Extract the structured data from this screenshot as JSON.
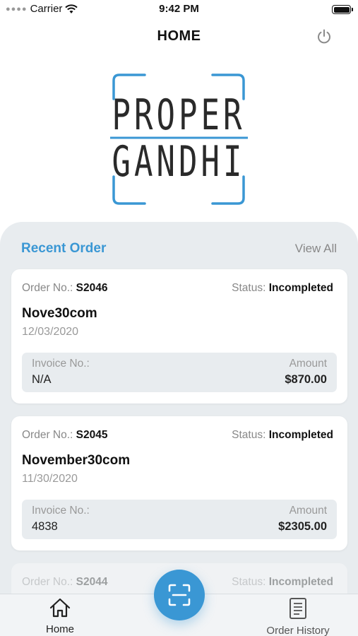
{
  "status_bar": {
    "carrier": "Carrier",
    "time": "9:42 PM"
  },
  "header": {
    "title": "HOME",
    "power_icon": "power-icon"
  },
  "logo": {
    "line1": "PROPER",
    "line2": "GANDHI",
    "accent_color": "#3a97d4"
  },
  "recent_orders": {
    "title": "Recent Order",
    "view_all": "View All",
    "orders": [
      {
        "order_label": "Order No.:",
        "order_no": "S2046",
        "status_label": "Status:",
        "status": "Incompleted",
        "name": "Nove30com",
        "date": "12/03/2020",
        "invoice_label": "Invoice No.:",
        "invoice_no": "N/A",
        "amount_label": "Amount",
        "amount": "$870.00"
      },
      {
        "order_label": "Order No.:",
        "order_no": "S2045",
        "status_label": "Status:",
        "status": "Incompleted",
        "name": "November30com",
        "date": "11/30/2020",
        "invoice_label": "Invoice No.:",
        "invoice_no": "4838",
        "amount_label": "Amount",
        "amount": "$2305.00"
      },
      {
        "order_label": "Order No.:",
        "order_no": "S2044",
        "status_label": "Status:",
        "status": "Incompleted"
      }
    ]
  },
  "tabbar": {
    "home_label": "Home",
    "history_label": "Order History",
    "scan_icon": "scan-icon"
  },
  "colors": {
    "accent": "#3a97d4",
    "panel_bg": "#e8ecef"
  }
}
